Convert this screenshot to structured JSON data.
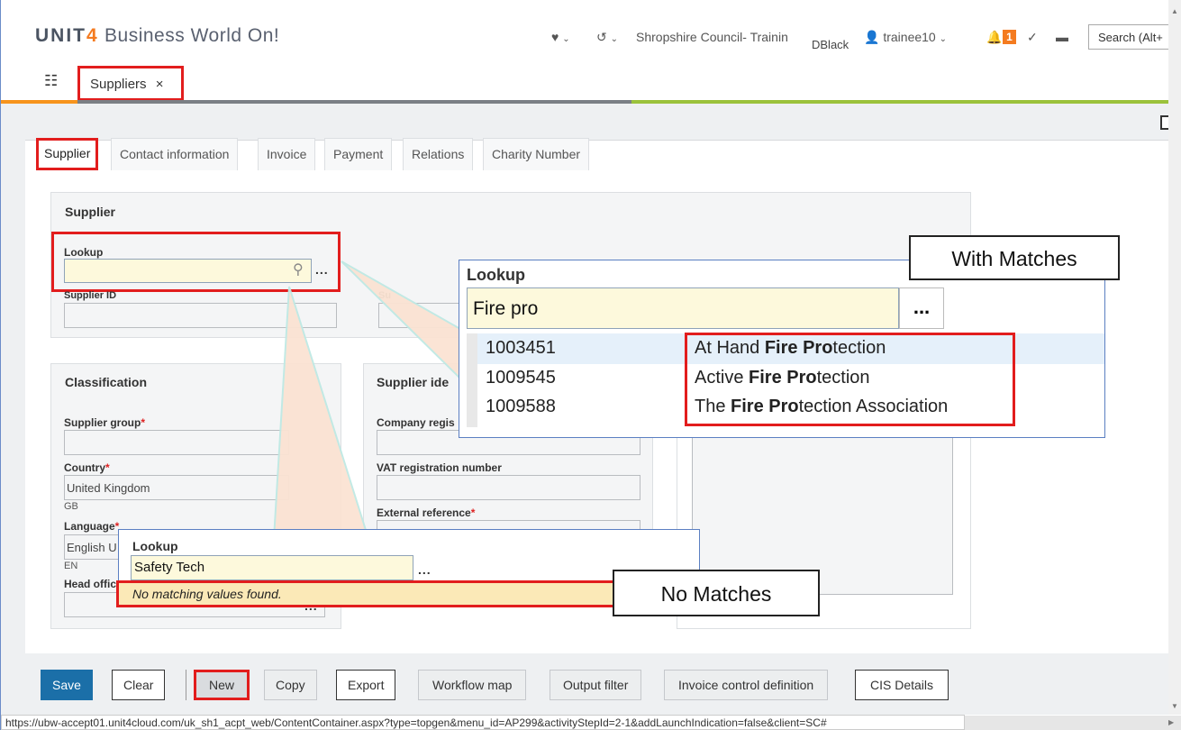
{
  "header": {
    "logo_brand": "UNIT4",
    "logo_product": "Business World On!",
    "client": "Shropshire Council- Trainin",
    "user_code": "DBlack",
    "username": "trainee10",
    "notification_count": "1",
    "search_placeholder": "Search (Alt+"
  },
  "app_tab": {
    "label": "Suppliers",
    "close": "×"
  },
  "form_tabs": [
    "Supplier",
    "Contact information",
    "Invoice",
    "Payment",
    "Relations",
    "Charity Number"
  ],
  "supplier_section": {
    "title": "Supplier",
    "lookup_label": "Lookup",
    "lookup_ellipsis": "...",
    "supplier_id_label": "Supplier ID",
    "supplier_name_label": "Su"
  },
  "classification": {
    "title": "Classification",
    "supplier_group_label": "Supplier group",
    "country_label": "Country",
    "country_value": "United Kingdom",
    "country_code": "GB",
    "language_label": "Language",
    "language_value": "English U",
    "language_code": "EN",
    "head_office_label": "Head offic",
    "required_mark": "*"
  },
  "supplier_identification": {
    "title": "Supplier ide",
    "company_reg_label": "Company regis",
    "vat_label": "VAT registration number",
    "external_ref_label": "External reference"
  },
  "with_matches": {
    "callout": "With Matches",
    "lookup_label": "Lookup",
    "input_value": "Fire pro",
    "ellipsis": "...",
    "results": [
      {
        "id": "1003451",
        "pre": "At Hand ",
        "match": "Fire Pro",
        "post": "tection"
      },
      {
        "id": "1009545",
        "pre": "Active ",
        "match": "Fire Pro",
        "post": "tection"
      },
      {
        "id": "1009588",
        "pre": "The ",
        "match": "Fire Pro",
        "post": "tection Association"
      }
    ]
  },
  "no_matches": {
    "callout": "No Matches",
    "lookup_label": "Lookup",
    "input_value": "Safety Tech",
    "ellipsis": "...",
    "message": "No matching values found."
  },
  "buttons": {
    "save": "Save",
    "clear": "Clear",
    "new": "New",
    "copy": "Copy",
    "export": "Export",
    "workflow_map": "Workflow map",
    "output_filter": "Output filter",
    "invoice_control": "Invoice control definition",
    "cis_details": "CIS Details"
  },
  "status_url": "https://ubw-accept01.unit4cloud.com/uk_sh1_acpt_web/ContentContainer.aspx?type=topgen&menu_id=AP299&activityStepId=2-1&addLaunchIndication=false&client=SC#",
  "colors": {
    "accent_red": "#e21d1d",
    "save_blue": "#1b6fa8",
    "unit4_orange": "#f47b20",
    "lookup_yellow": "#fdf9dc",
    "line_green": "#9bc23c"
  }
}
